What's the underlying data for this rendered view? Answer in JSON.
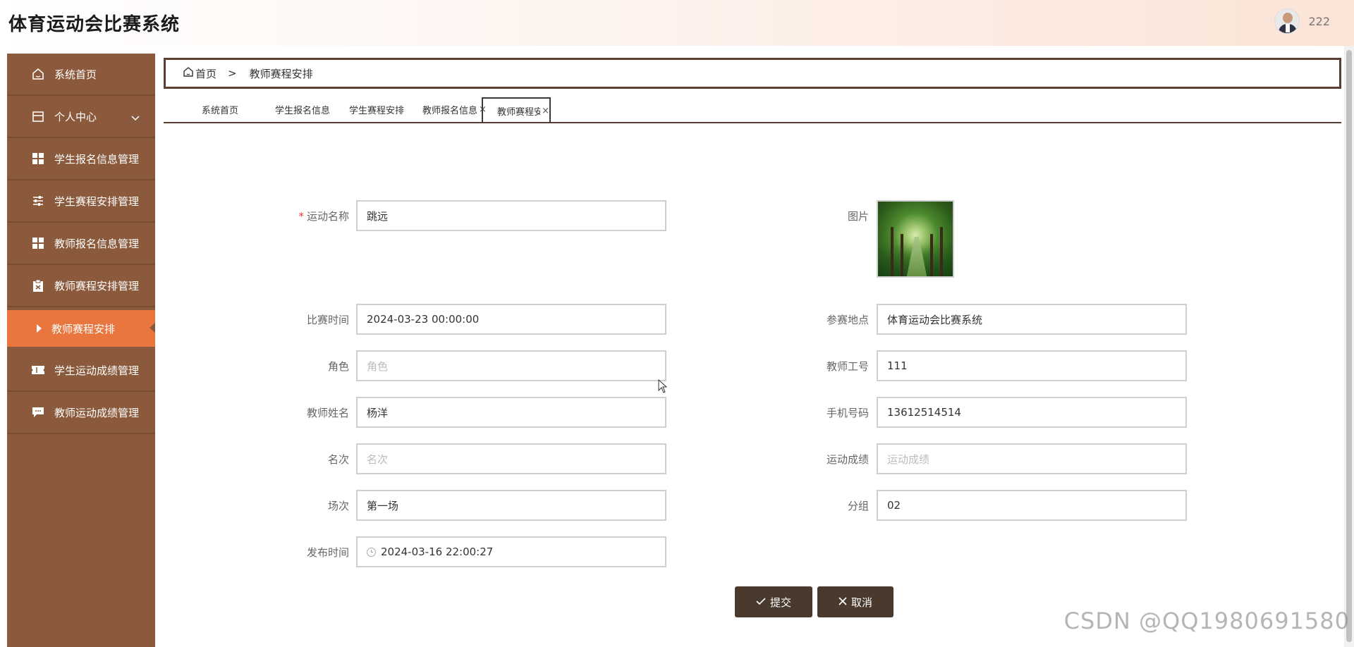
{
  "app": {
    "title": "体育运动会比赛系统",
    "username": "222"
  },
  "sidebar": {
    "items": [
      {
        "label": "系统首页",
        "icon": "home-icon"
      },
      {
        "label": "个人中心",
        "icon": "calendar-icon"
      },
      {
        "label": "学生报名信息管理",
        "icon": "grid-icon"
      },
      {
        "label": "学生赛程安排管理",
        "icon": "sliders-icon"
      },
      {
        "label": "教师报名信息管理",
        "icon": "grid-icon"
      },
      {
        "label": "教师赛程安排管理",
        "icon": "clipboard-icon"
      },
      {
        "label": "教师赛程安排",
        "icon": "caret-right-icon",
        "active": true
      },
      {
        "label": "学生运动成绩管理",
        "icon": "ticket-icon"
      },
      {
        "label": "教师运动成绩管理",
        "icon": "chat-icon"
      }
    ]
  },
  "breadcrumb": {
    "home": "首页",
    "separator": ">",
    "current": "教师赛程安排"
  },
  "tabs": [
    {
      "label": "系统首页"
    },
    {
      "label": "学生报名信息"
    },
    {
      "label": "学生赛程安排"
    },
    {
      "label": "教师报名信息",
      "close": "×"
    },
    {
      "label": "教师赛程安排",
      "close": "×",
      "active": true
    }
  ],
  "form": {
    "sport_name": {
      "label": "运动名称",
      "required": "*",
      "value": "跳远"
    },
    "image": {
      "label": "图片"
    },
    "match_time": {
      "label": "比赛时间",
      "value": "2024-03-23 00:00:00"
    },
    "venue": {
      "label": "参赛地点",
      "value": "体育运动会比赛系统"
    },
    "role": {
      "label": "角色",
      "placeholder": "角色"
    },
    "teacher_id": {
      "label": "教师工号",
      "value": "111"
    },
    "teacher_name": {
      "label": "教师姓名",
      "value": "杨洋"
    },
    "phone": {
      "label": "手机号码",
      "value": "13612514514"
    },
    "rank": {
      "label": "名次",
      "placeholder": "名次"
    },
    "score": {
      "label": "运动成绩",
      "placeholder": "运动成绩"
    },
    "session": {
      "label": "场次",
      "value": "第一场"
    },
    "group": {
      "label": "分组",
      "value": "02"
    },
    "publish_time": {
      "label": "发布时间",
      "value": "2024-03-16 22:00:27"
    }
  },
  "buttons": {
    "submit": "提交",
    "cancel": "取消"
  },
  "watermark": "CSDN @QQ1980691580",
  "colors": {
    "sidebar": "#8b5a3c",
    "active": "#e8763e",
    "button": "#4a3a2e"
  }
}
